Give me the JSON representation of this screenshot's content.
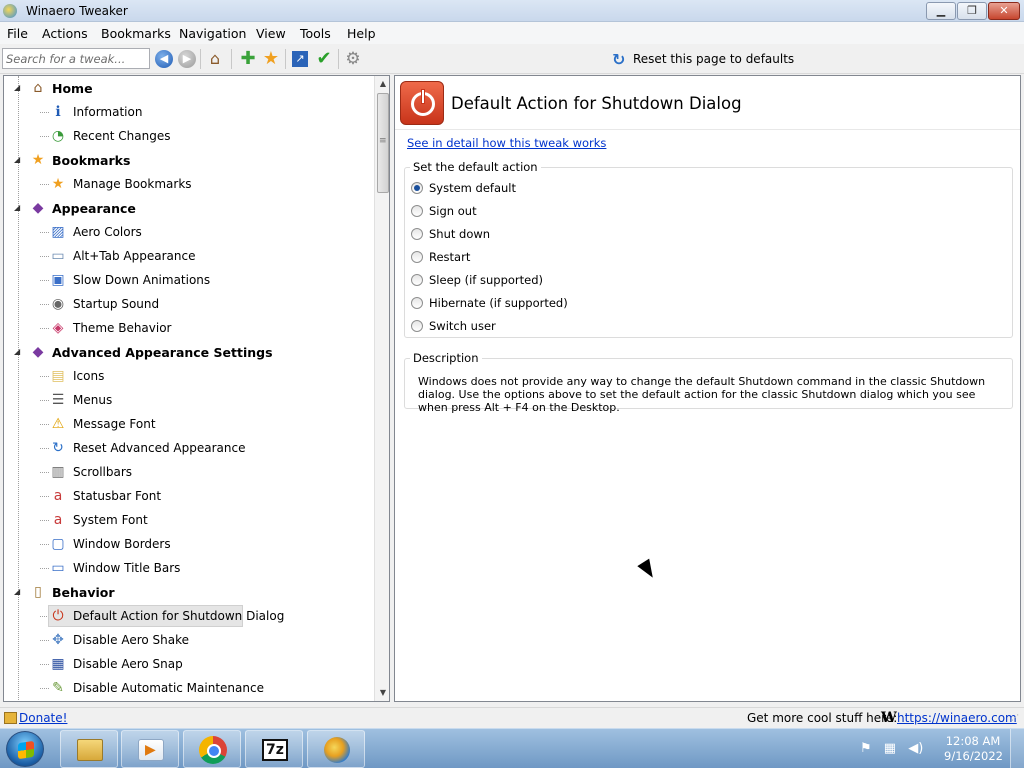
{
  "window": {
    "title": "Winaero Tweaker"
  },
  "menu": [
    "File",
    "Actions",
    "Bookmarks",
    "Navigation",
    "View",
    "Tools",
    "Help"
  ],
  "toolbar": {
    "search_placeholder": "Search for a tweak...",
    "reset_label": "Reset this page to defaults"
  },
  "tree": {
    "items": [
      {
        "label": "Home",
        "level": 0,
        "icon": "home-icon"
      },
      {
        "label": "Information",
        "level": 1,
        "icon": "info-icon"
      },
      {
        "label": "Recent Changes",
        "level": 1,
        "icon": "clock-icon"
      },
      {
        "label": "Bookmarks",
        "level": 0,
        "icon": "star-icon"
      },
      {
        "label": "Manage Bookmarks",
        "level": 1,
        "icon": "star-icon"
      },
      {
        "label": "Appearance",
        "level": 0,
        "icon": "appearance-icon"
      },
      {
        "label": "Aero Colors",
        "level": 1,
        "icon": "palette-icon"
      },
      {
        "label": "Alt+Tab Appearance",
        "level": 1,
        "icon": "window-icon"
      },
      {
        "label": "Slow Down Animations",
        "level": 1,
        "icon": "animation-icon"
      },
      {
        "label": "Startup Sound",
        "level": 1,
        "icon": "speaker-icon"
      },
      {
        "label": "Theme Behavior",
        "level": 1,
        "icon": "theme-icon"
      },
      {
        "label": "Advanced Appearance Settings",
        "level": 0,
        "icon": "appearance-icon"
      },
      {
        "label": "Icons",
        "level": 1,
        "icon": "icons-icon"
      },
      {
        "label": "Menus",
        "level": 1,
        "icon": "menu-icon"
      },
      {
        "label": "Message Font",
        "level": 1,
        "icon": "warning-icon"
      },
      {
        "label": "Reset Advanced Appearance",
        "level": 1,
        "icon": "reset-icon"
      },
      {
        "label": "Scrollbars",
        "level": 1,
        "icon": "scrollbar-icon"
      },
      {
        "label": "Statusbar Font",
        "level": 1,
        "icon": "font-icon"
      },
      {
        "label": "System Font",
        "level": 1,
        "icon": "font-icon"
      },
      {
        "label": "Window Borders",
        "level": 1,
        "icon": "border-icon"
      },
      {
        "label": "Window Title Bars",
        "level": 1,
        "icon": "titlebar-icon"
      },
      {
        "label": "Behavior",
        "level": 0,
        "icon": "behavior-icon"
      },
      {
        "label": "Default Action for Shutdown Dialog",
        "level": 1,
        "icon": "power-icon",
        "selected": true
      },
      {
        "label": "Disable Aero Shake",
        "level": 1,
        "icon": "shake-icon"
      },
      {
        "label": "Disable Aero Snap",
        "level": 1,
        "icon": "snap-icon"
      },
      {
        "label": "Disable Automatic Maintenance",
        "level": 1,
        "icon": "maintenance-icon"
      }
    ]
  },
  "page": {
    "title": "Default Action for Shutdown Dialog",
    "detail_link": "See in detail how this tweak works",
    "actions_group": "Set the default action",
    "options": [
      {
        "label": "System default",
        "checked": true
      },
      {
        "label": "Sign out",
        "checked": false
      },
      {
        "label": "Shut down",
        "checked": false
      },
      {
        "label": "Restart",
        "checked": false
      },
      {
        "label": "Sleep (if supported)",
        "checked": false
      },
      {
        "label": "Hibernate (if supported)",
        "checked": false
      },
      {
        "label": "Switch user",
        "checked": false
      }
    ],
    "description_group": "Description",
    "description": "Windows does not provide any way to change the default Shutdown command in the classic Shutdown dialog. Use the options above to set the default action for the classic Shutdown dialog which you see when press Alt + F4 on the Desktop."
  },
  "statusbar": {
    "donate": "Donate!",
    "more": "Get more cool stuff here:",
    "logo": "W",
    "url": "https://winaero.com"
  },
  "taskbar": {
    "apps": [
      "explorer",
      "media-player",
      "chrome",
      "7-zip",
      "winaero-tweaker"
    ],
    "sevenzip_label": "7z",
    "time": "12:08 AM",
    "date": "9/16/2022"
  }
}
